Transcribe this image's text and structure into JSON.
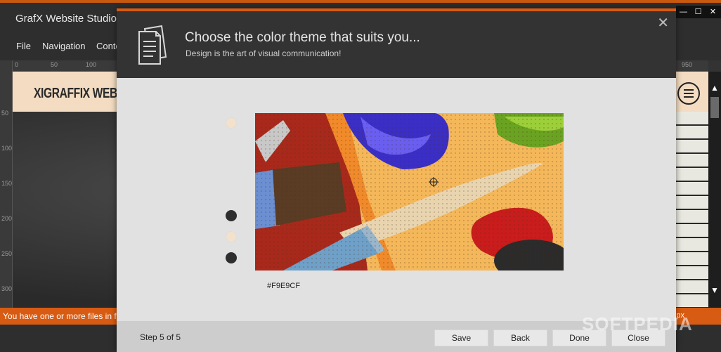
{
  "app": {
    "title": "GrafX Website Studio",
    "window_controls": [
      "—",
      "☐",
      "✕"
    ],
    "menu": [
      "File",
      "Navigation",
      "Conte"
    ]
  },
  "rulers": {
    "top_labels": [
      "0",
      "50",
      "100",
      "950"
    ],
    "left_labels": [
      "50",
      "100",
      "150",
      "200",
      "250",
      "300"
    ]
  },
  "site": {
    "logo": "XIGRAFFIX WEBDE"
  },
  "status": {
    "message": "You have one or more files in f",
    "right": "px"
  },
  "dialog": {
    "title": "Choose the color theme that suits you...",
    "subtitle": "Design is the art of visual communication!",
    "close_glyph": "✕",
    "swatches": [
      "#F3E1CB",
      "#2E2E2E",
      "#F3E1CB",
      "#2E2E2E"
    ],
    "hex_value": "#F9E9CF",
    "step": "Step 5 of 5",
    "buttons": {
      "save": "Save",
      "back": "Back",
      "done": "Done",
      "close": "Close"
    }
  },
  "watermark": "SOFTPEDIA",
  "colors": {
    "accent": "#D75B12",
    "dialog_header": "#333333",
    "dialog_body": "#E1E1E1"
  }
}
